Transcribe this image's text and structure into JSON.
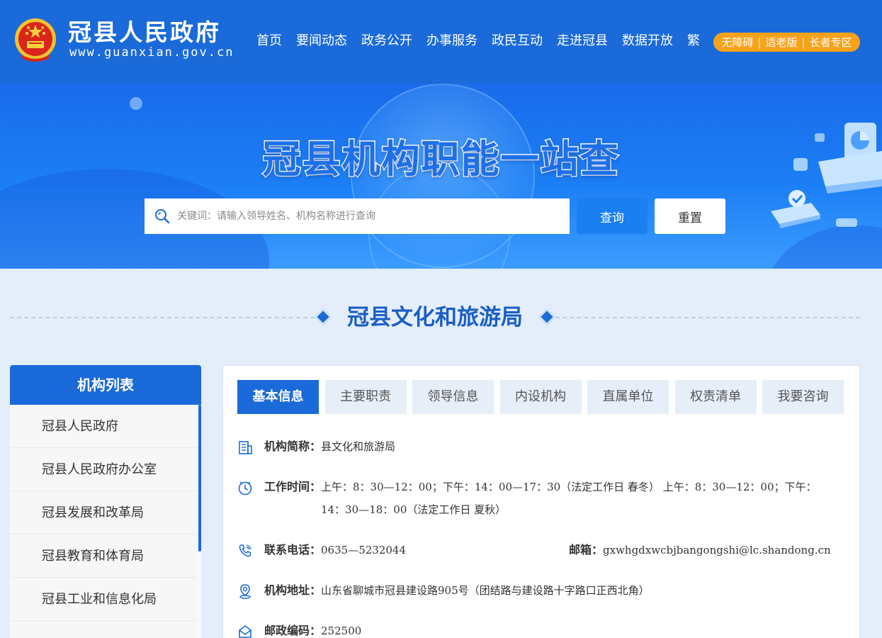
{
  "header": {
    "site_title": "冠县人民政府",
    "site_url": "www.guanxian.gov.cn",
    "nav": [
      "首页",
      "要闻动态",
      "政务公开",
      "办事服务",
      "政民互动",
      "走进冠县",
      "数据开放",
      "繁"
    ],
    "access": [
      "无障碍",
      "适老版",
      "长者专区"
    ]
  },
  "banner": {
    "title": "冠县机构职能一站查",
    "search_placeholder": "关键词：请输入领导姓名、机构名称进行查询",
    "search_value": "",
    "query_label": "查询",
    "reset_label": "重置"
  },
  "section": {
    "title": "冠县文化和旅游局"
  },
  "sidebar": {
    "title": "机构列表",
    "items": [
      "冠县人民政府",
      "冠县人民政府办公室",
      "冠县发展和改革局",
      "冠县教育和体育局",
      "冠县工业和信息化局"
    ]
  },
  "tabs": [
    "基本信息",
    "主要职责",
    "领导信息",
    "内设机构",
    "直属单位",
    "权责清单",
    "我要咨询"
  ],
  "info": {
    "short_name_label": "机构简称：",
    "short_name": "县文化和旅游局",
    "hours_label": "工作时间：",
    "hours": "上午：8：30—12：00；下午：14：00—17：30（法定工作日 春冬） 上午：8：30—12：00；下午：14：30—18：00（法定工作日 夏秋）",
    "phone_label": "联系电话：",
    "phone": "0635—5232044",
    "email_label": "邮箱：",
    "email": "gxwhgdxwcbjbangongshi@lc.shandong.cn",
    "address_label": "机构地址：",
    "address": "山东省聊城市冠县建设路905号（团结路与建设路十字路口正西北角）",
    "postcode_label": "邮政编码：",
    "postcode": "252500"
  },
  "colors": {
    "primary": "#1a6ad9",
    "accent": "#f7a21b",
    "page_bg": "#e4eefa"
  }
}
